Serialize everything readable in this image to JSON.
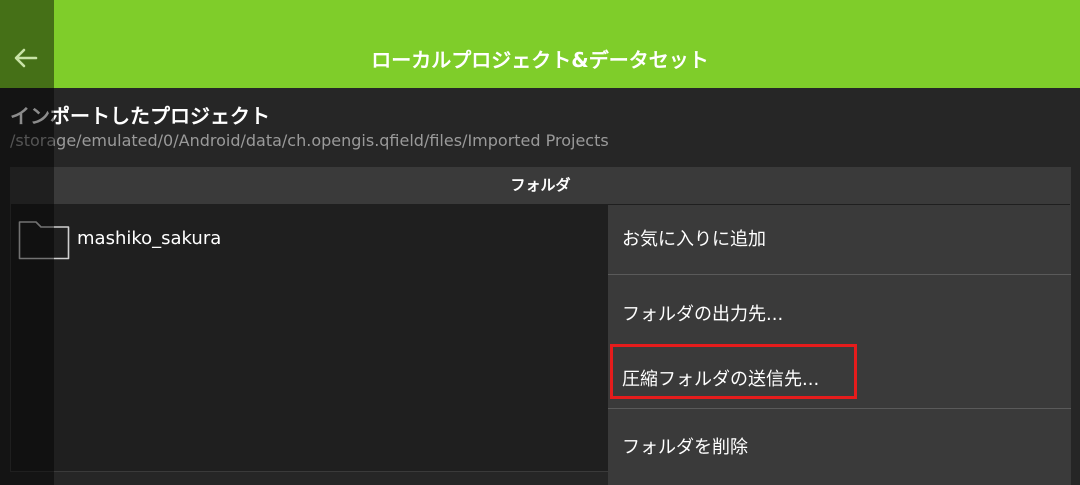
{
  "header": {
    "title": "ローカルプロジェクト&データセット",
    "back_icon": "arrow-left-icon",
    "background_color": "#7fcd2a"
  },
  "section": {
    "title": "インポートしたプロジェクト",
    "path": "/storage/emulated/0/Android/data/ch.opengis.qfield/files/Imported Projects"
  },
  "list": {
    "header": "フォルダ",
    "items": [
      {
        "label": "mashiko_sakura",
        "icon": "folder-icon"
      }
    ]
  },
  "context_menu": {
    "items": [
      {
        "label": "お気に入りに追加"
      },
      {
        "label": "フォルダの出力先..."
      },
      {
        "label": "圧縮フォルダの送信先..."
      },
      {
        "label": "フォルダを削除"
      }
    ],
    "highlight_color": "#e51c1c"
  }
}
